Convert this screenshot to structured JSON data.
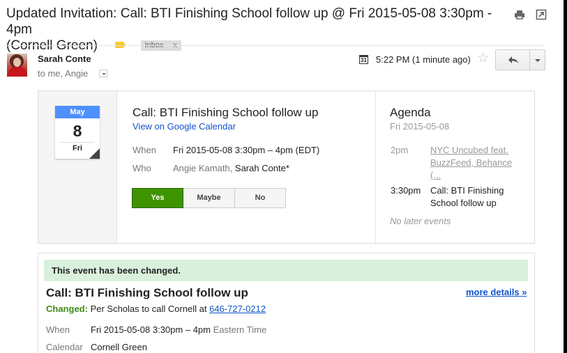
{
  "subject": {
    "line1": "Updated Invitation: Call: BTI Finishing School follow up @ Fri 2015-05-08 3:30pm - 4pm",
    "line2": "(Cornell Green)",
    "label_color": "#f5c934",
    "inbox_chip": "Inbox",
    "inbox_chip_close": "x"
  },
  "toolbar": {
    "print_icon": "print-icon",
    "new_window_icon": "new-window-icon"
  },
  "message": {
    "sender": "Sarah Conte",
    "recipients": "to me, Angie",
    "time": "5:22 PM (1 minute ago)",
    "calendar_icon_day": "31"
  },
  "invite": {
    "badge": {
      "month": "May",
      "day": "8",
      "dow": "Fri"
    },
    "title": "Call: BTI Finishing School follow up",
    "view_link": "View on Google Calendar",
    "when_label": "When",
    "when_value": "Fri 2015-05-08 3:30pm – 4pm (EDT)",
    "who_label": "Who",
    "who_guests": "Angie Kamath,",
    "who_organizer": "Sarah Conte*",
    "rsvp": {
      "yes": "Yes",
      "maybe": "Maybe",
      "no": "No"
    },
    "accent": "#3d9400"
  },
  "agenda": {
    "title": "Agenda",
    "date": "Fri 2015-05-08",
    "events": [
      {
        "time": "2pm",
        "title": "NYC Uncubed feat. BuzzFeed, Behance (..."
      },
      {
        "time": "3:30pm",
        "title": "Call: BTI Finishing School follow up"
      }
    ],
    "no_later": "No later events"
  },
  "details": {
    "banner": "This event has been changed.",
    "title": "Call: BTI Finishing School follow up",
    "more_details": "more details »",
    "changed_label": "Changed:",
    "changed_text": " Per Scholas to call Cornell at ",
    "phone": "646-727-0212",
    "when_label": "When",
    "when_value": "Fri 2015-05-08 3:30pm – 4pm",
    "timezone": " Eastern Time",
    "calendar_label": "Calendar",
    "calendar_value": "Cornell Green"
  }
}
